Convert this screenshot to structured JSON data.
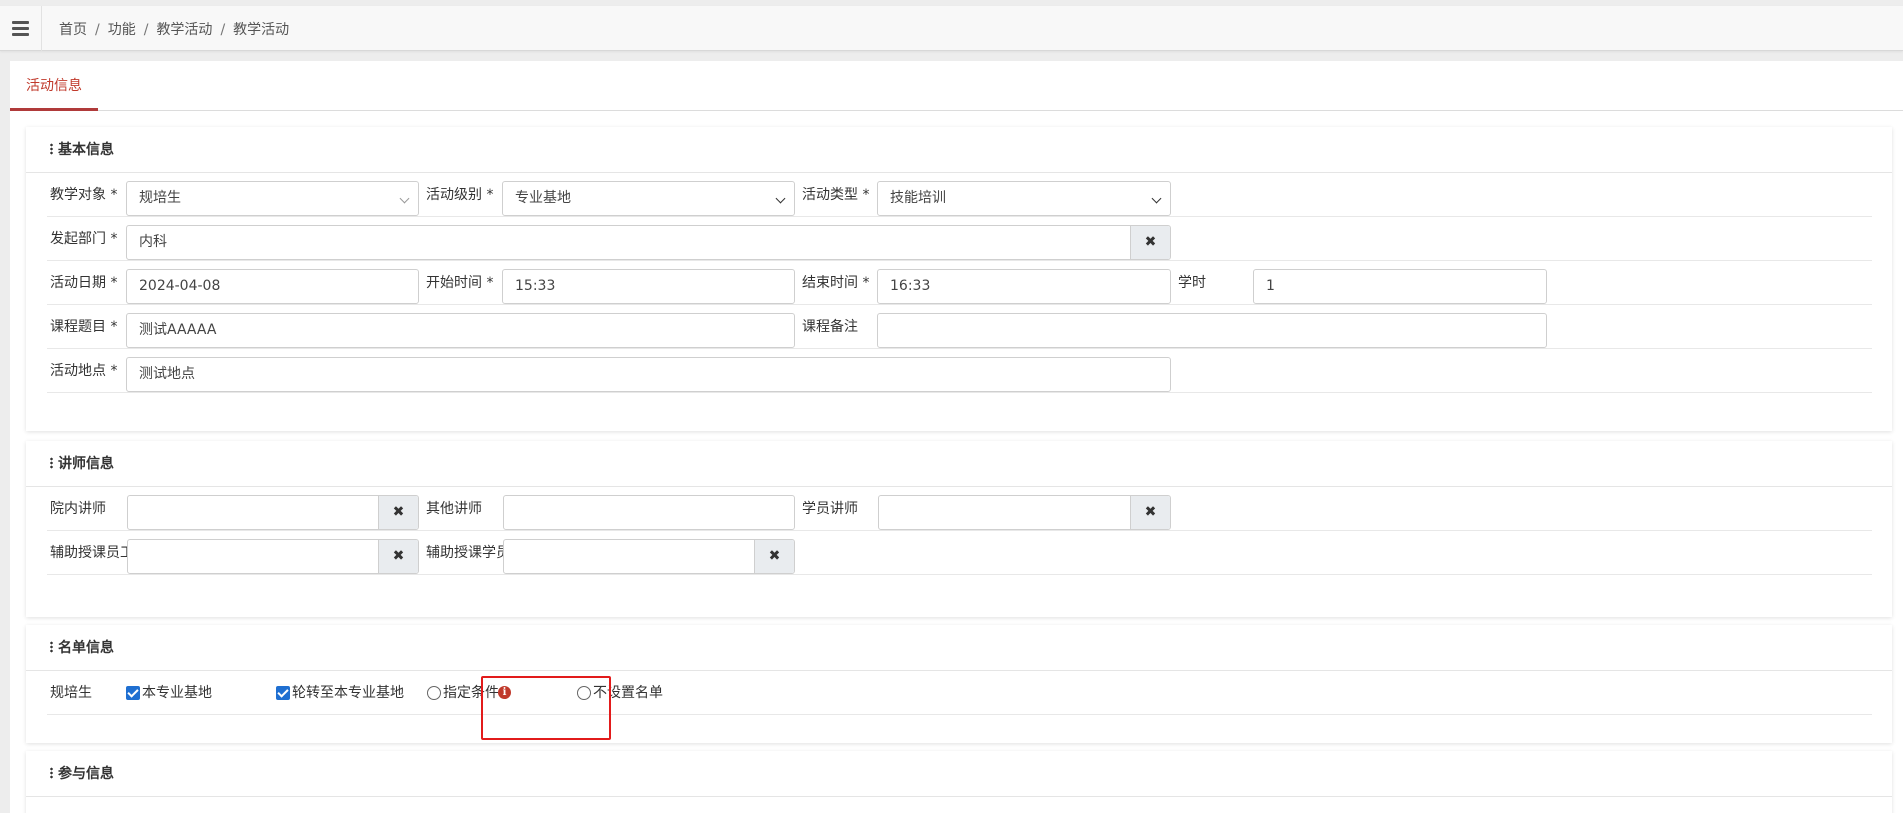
{
  "breadcrumb": [
    "首页",
    "功能",
    "教学活动",
    "教学活动"
  ],
  "tabs": {
    "active": "活动信息"
  },
  "sections": {
    "basic": "基本信息",
    "lecturer": "讲师信息",
    "roster": "名单信息",
    "participation": "参与信息"
  },
  "basic": {
    "target_label": "教学对象 *",
    "target_value": "规培生",
    "level_label": "活动级别 *",
    "level_value": "专业基地",
    "type_label": "活动类型 *",
    "type_value": "技能培训",
    "dept_label": "发起部门 *",
    "dept_value": "内科",
    "date_label": "活动日期 *",
    "date_value": "2024-04-08",
    "start_label": "开始时间 *",
    "start_value": "15:33",
    "end_label": "结束时间 *",
    "end_value": "16:33",
    "hours_label": "学时",
    "hours_value": "1",
    "topic_label": "课程题目 *",
    "topic_value": "测试AAAAA",
    "remark_label": "课程备注",
    "remark_value": "",
    "location_label": "活动地点 *",
    "location_value": "测试地点"
  },
  "lecturer": {
    "internal_label": "院内讲师",
    "internal_value": "",
    "other_label": "其他讲师",
    "other_value": "",
    "student_label": "学员讲师",
    "student_value": "",
    "assist_staff_label": "辅助授课员工",
    "assist_staff_value": "",
    "assist_student_label": "辅助授课学员",
    "assist_student_value": ""
  },
  "roster": {
    "row_label": "规培生",
    "options": [
      {
        "label": "本专业基地",
        "type": "checkbox",
        "checked": true
      },
      {
        "label": "轮转至本专业基地",
        "type": "checkbox",
        "checked": true
      },
      {
        "label": "指定条件",
        "type": "radio",
        "checked": false
      },
      {
        "label": "不设置名单",
        "type": "radio",
        "checked": false
      }
    ]
  },
  "icons": {
    "clear": "✖",
    "info": "i"
  },
  "colors": {
    "tab_accent": "#c0392b",
    "checkbox": "#1f6fd1",
    "highlight_box": "#e21b1b"
  }
}
